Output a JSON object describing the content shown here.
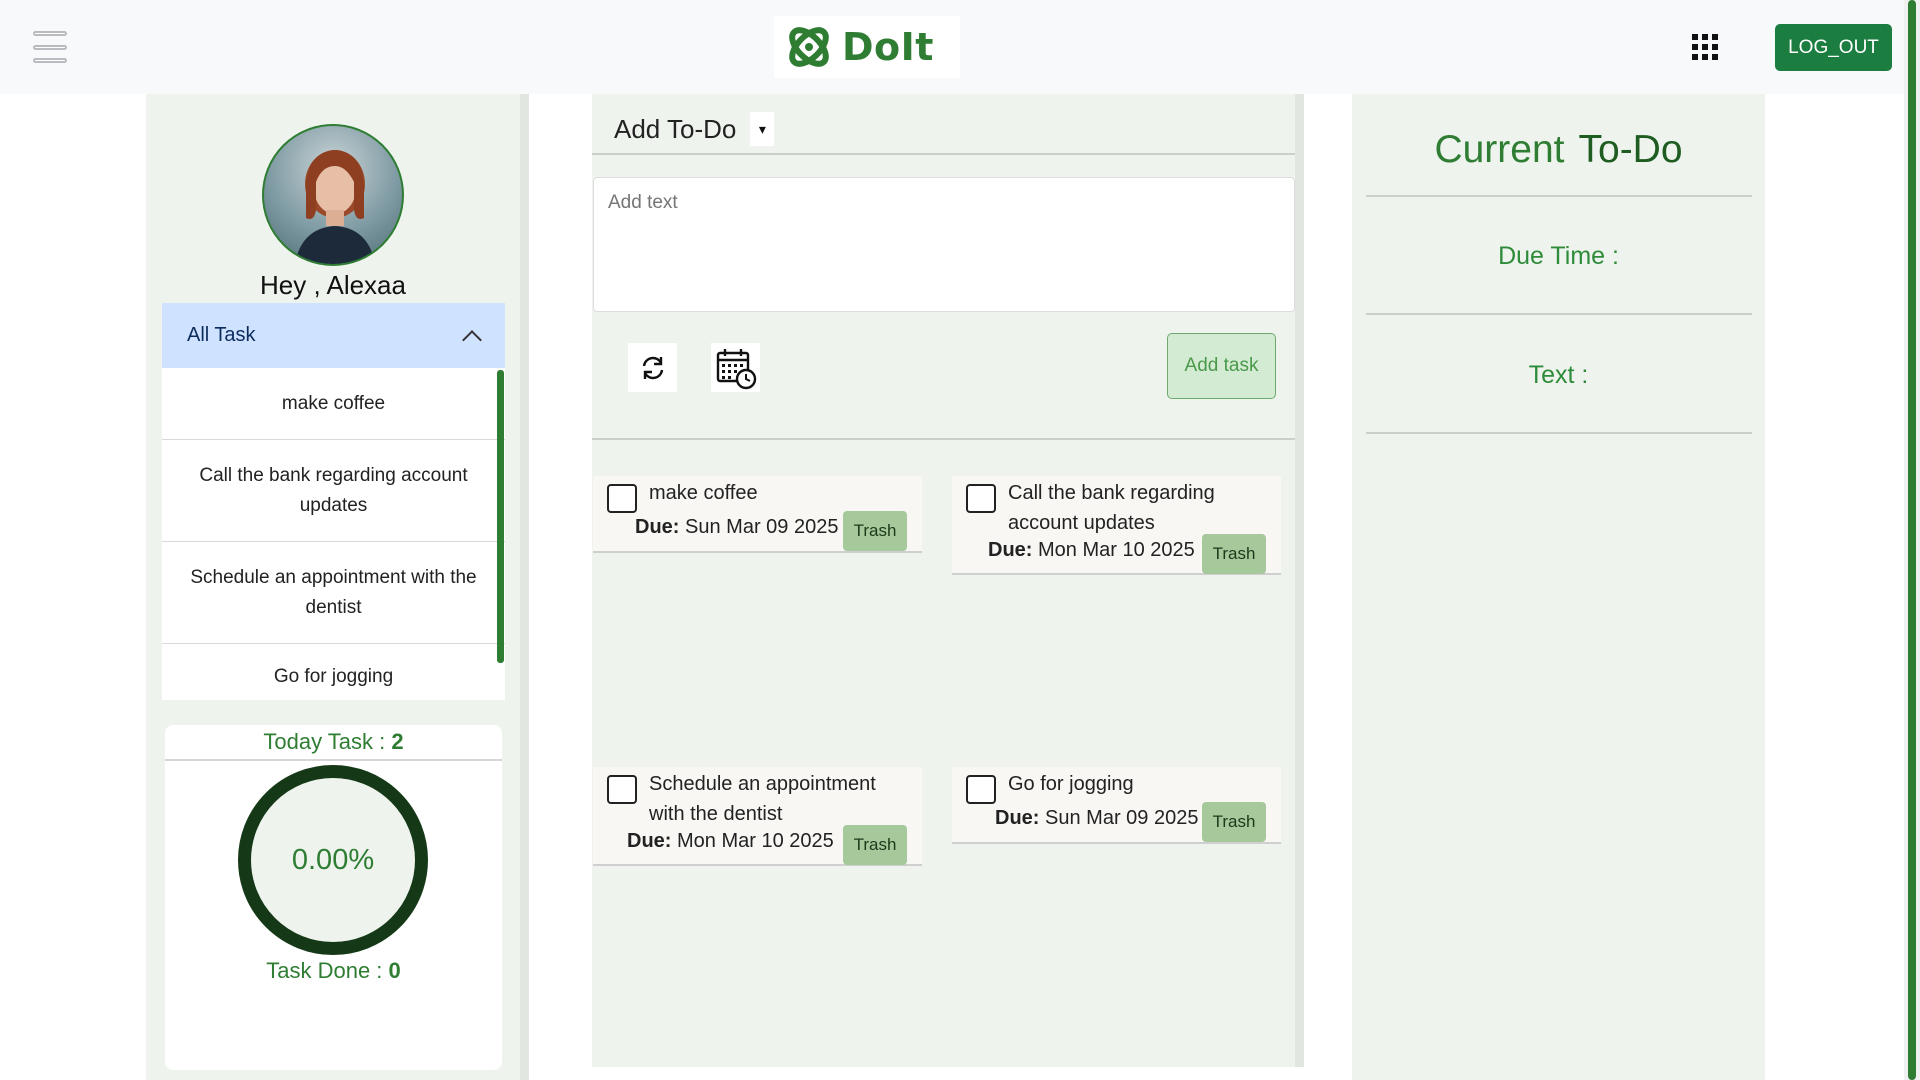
{
  "header": {
    "brand": "DoIt",
    "logout_label": "LOG_OUT"
  },
  "sidebar": {
    "greeting": "Hey , Alexaa",
    "accordion_title": "All Task",
    "tasks": [
      "make coffee",
      "Call the bank regarding account updates",
      "Schedule an appointment with the dentist",
      "Go for jogging"
    ],
    "stats": {
      "today_label": "Today Task : ",
      "today_count": "2",
      "progress": "0.00%",
      "done_label": "Task Done : ",
      "done_count": "0"
    }
  },
  "composer": {
    "title": "Add To-Do",
    "caret": "▾",
    "placeholder": "Add text",
    "add_button": "Add task"
  },
  "cards": [
    {
      "title": "make coffee",
      "due_label": "Due:",
      "due": "Sun Mar 09 2025",
      "trash": "Trash"
    },
    {
      "title": "Call the bank regarding account updates",
      "due_label": "Due:",
      "due": "Mon Mar 10 2025",
      "trash": "Trash"
    },
    {
      "title": "Schedule an appointment with the dentist",
      "due_label": "Due:",
      "due": "Mon Mar 10 2025",
      "trash": "Trash"
    },
    {
      "title": "Go for jogging",
      "due_label": "Due:",
      "due": "Sun Mar 09 2025",
      "trash": "Trash"
    }
  ],
  "current": {
    "word1": "Current",
    "word2": "To-Do",
    "due_time_label": "Due Time :",
    "text_label": "Text :"
  },
  "colors": {
    "brand_green": "#2e7d32",
    "logout_bg": "#1b7d3f",
    "panel_bg": "#eef4ed",
    "accordion_bg": "#cfe2ff",
    "trash_bg": "#a6c99c"
  },
  "icons": {
    "menu": "hamburger-icon",
    "brand": "atom-logo-icon",
    "apps": "grid-apps-icon",
    "refresh": "refresh-icon",
    "calendar": "calendar-clock-icon",
    "collapse": "chevron-up-icon"
  }
}
